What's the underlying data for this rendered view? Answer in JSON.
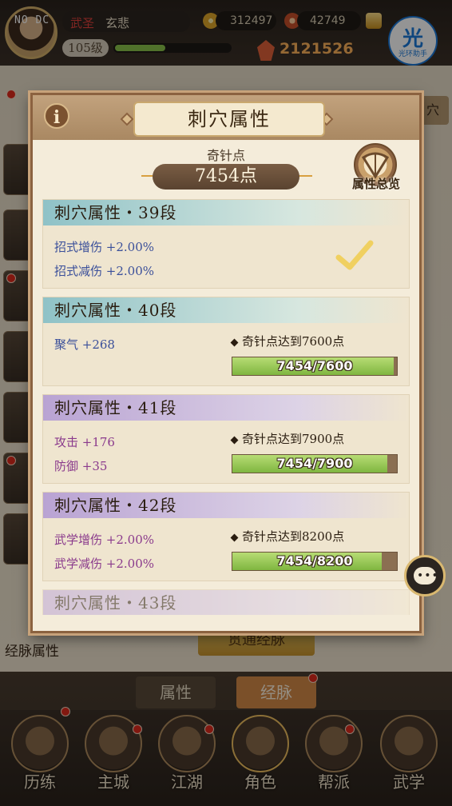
{
  "hud": {
    "avatar_tag": "NO DC",
    "player_title": "武圣",
    "player_name": "玄悲",
    "level": "105级",
    "exp_fraction": 0.44,
    "currency_1": "312497",
    "currency_2": "42749",
    "power": "2121526",
    "assistant_glyph": "光",
    "assistant_label": "光环助手"
  },
  "background": {
    "right_tab": "穴",
    "left_tab": "经脉属性",
    "bottom_button": "贯通经脉",
    "subtabs": [
      "属性",
      "经脉"
    ]
  },
  "bottom_nav": [
    {
      "label": "历练",
      "icon": "training-icon"
    },
    {
      "label": "主城",
      "icon": "city-icon"
    },
    {
      "label": "江湖",
      "icon": "world-icon"
    },
    {
      "label": "角色",
      "icon": "character-icon"
    },
    {
      "label": "帮派",
      "icon": "guild-icon"
    },
    {
      "label": "武学",
      "icon": "martial-arts-icon"
    }
  ],
  "modal": {
    "title": "刺穴属性",
    "points_label": "奇针点",
    "points_value": "7454点",
    "overview_label": "属性总览",
    "tiers": [
      {
        "title": "刺穴属性・39段",
        "theme": "cyan",
        "stats": [
          "招式增伤 +2.00%",
          "招式减伤 +2.00%"
        ],
        "stat_color": "blue",
        "completed": true
      },
      {
        "title": "刺穴属性・40段",
        "theme": "cyan",
        "stats": [
          "聚气 +268"
        ],
        "stat_color": "blue",
        "requirement": "奇针点达到7600点",
        "progress_text": "7454/7600",
        "current": 7454,
        "target": 7600
      },
      {
        "title": "刺穴属性・41段",
        "theme": "purple",
        "stats": [
          "攻击 +176",
          "防御 +35"
        ],
        "stat_color": "purple",
        "requirement": "奇针点达到7900点",
        "progress_text": "7454/7900",
        "current": 7454,
        "target": 7900
      },
      {
        "title": "刺穴属性・42段",
        "theme": "purple",
        "stats": [
          "武学增伤 +2.00%",
          "武学减伤 +2.00%"
        ],
        "stat_color": "purple",
        "requirement": "奇针点达到8200点",
        "progress_text": "7454/8200",
        "current": 7454,
        "target": 8200
      },
      {
        "title": "刺穴属性・43段",
        "theme": "purple",
        "stats": [],
        "stat_color": "purple"
      }
    ]
  }
}
